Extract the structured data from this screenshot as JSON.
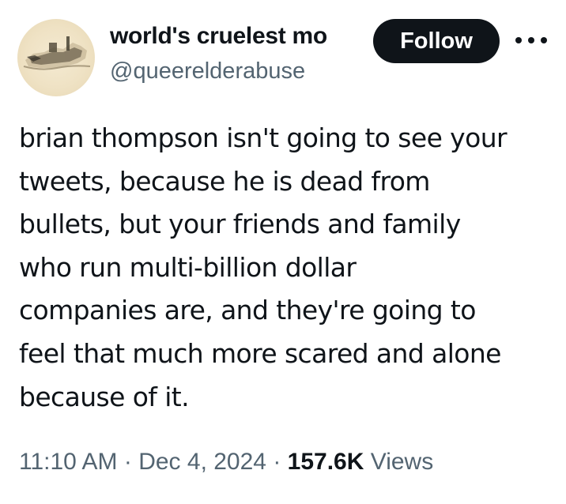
{
  "author": {
    "display_name": "world's cruelest mo",
    "handle": "@queerelderabuse"
  },
  "actions": {
    "follow_label": "Follow"
  },
  "tweet": {
    "lines": [
      "brian thompson isn't going to see your",
      "tweets, because he is dead from",
      "bullets, but your friends and family",
      "who run multi-billion dollar",
      "companies are, and they're going to",
      "feel that much more scared and alone",
      "because of it."
    ]
  },
  "meta": {
    "time": "11:10 AM",
    "separator": " · ",
    "date": "Dec 4, 2024",
    "views_count": "157.6K",
    "views_label": " Views"
  },
  "icons": {
    "more": "more-horizontal-icon",
    "avatar": "avatar-image"
  },
  "colors": {
    "text": "#0f1419",
    "secondary": "#536471",
    "follow_bg": "#0f1419",
    "follow_text": "#ffffff"
  }
}
